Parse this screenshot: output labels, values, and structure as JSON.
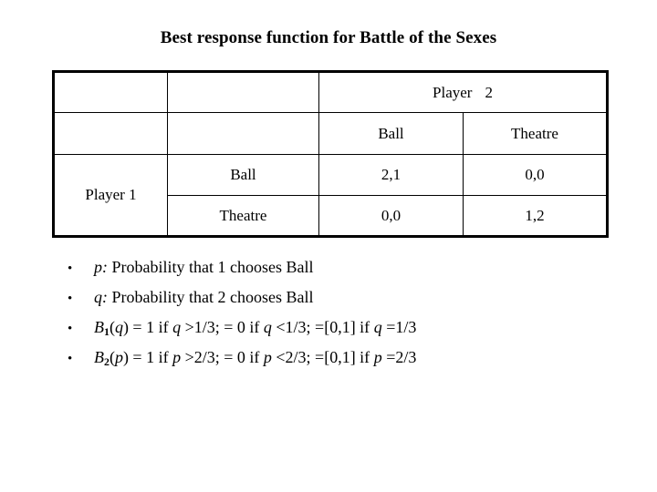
{
  "slide": {
    "title": "Best response function for Battle of the Sexes",
    "background_color": "#ffffff",
    "text_color": "#000000"
  },
  "matrix": {
    "column_player_label": "Player",
    "column_player_number": "2",
    "row_player_label": "Player 1",
    "column_actions": [
      "Ball",
      "Theatre"
    ],
    "row_actions": [
      "Ball",
      "Theatre"
    ],
    "payoffs": [
      [
        "2,1",
        "0,0"
      ],
      [
        "0,0",
        "1,2"
      ]
    ],
    "border_color": "#000000"
  },
  "bullets": {
    "marker": "•",
    "items": [
      {
        "id": "p-definition",
        "symbol": "p:",
        "rest": " Probability that 1 chooses Ball"
      },
      {
        "id": "q-definition",
        "symbol": "q:",
        "rest": " Probability that 2 chooses Ball"
      },
      {
        "id": "best-response-1",
        "fn_name": "B",
        "fn_sub": "1",
        "arg": "q",
        "seg1": ") = 1 if ",
        "var1": "q",
        "seg2": " >1/3; = 0 if ",
        "var2": "q",
        "seg3": " <1/3; =[0,1] if ",
        "var3": "q",
        "seg4": " =1/3"
      },
      {
        "id": "best-response-2",
        "fn_name": "B",
        "fn_sub": "2",
        "arg": "p",
        "seg1": ") = 1 if ",
        "var1": "p",
        "seg2": " >2/3; = 0 if ",
        "var2": "p",
        "seg3": " <2/3; =[0,1] if ",
        "var3": "p",
        "seg4": " =2/3"
      }
    ]
  }
}
